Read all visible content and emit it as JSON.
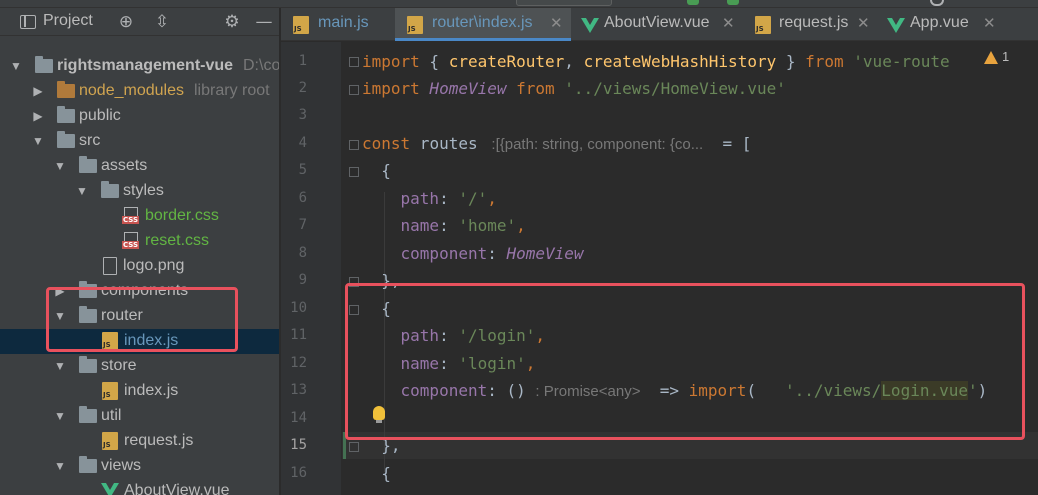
{
  "panel": {
    "title": "Project",
    "toolbar_icons": [
      "target-icon",
      "collapse-icon",
      "gear-icon",
      "minimize-icon"
    ]
  },
  "tree": {
    "root": {
      "label": "rightsmanagement-vue",
      "path_hint": "D:\\co"
    },
    "items": [
      {
        "label": "node_modules",
        "hint": "library root"
      },
      {
        "label": "public"
      },
      {
        "label": "src"
      },
      {
        "label": "assets"
      },
      {
        "label": "styles"
      },
      {
        "label": "border.css"
      },
      {
        "label": "reset.css"
      },
      {
        "label": "logo.png"
      },
      {
        "label": "components"
      },
      {
        "label": "router"
      },
      {
        "label": "index.js"
      },
      {
        "label": "store"
      },
      {
        "label": "index.js"
      },
      {
        "label": "util"
      },
      {
        "label": "request.js"
      },
      {
        "label": "views"
      },
      {
        "label": "AboutView.vue"
      }
    ]
  },
  "tabs": [
    {
      "label": "main.js",
      "icon": "js-file-icon"
    },
    {
      "label": "router\\index.js",
      "icon": "js-file-icon",
      "active": true
    },
    {
      "label": "AboutView.vue",
      "icon": "vue-file-icon"
    },
    {
      "label": "request.js",
      "icon": "js-file-icon"
    },
    {
      "label": "App.vue",
      "icon": "vue-file-icon"
    }
  ],
  "editor": {
    "line_numbers": [
      "1",
      "2",
      "3",
      "4",
      "5",
      "6",
      "7",
      "8",
      "9",
      "10",
      "11",
      "12",
      "13",
      "14",
      "15",
      "16"
    ],
    "current_line": "15",
    "warning_count": "1",
    "code": {
      "l1": {
        "kw1": "import",
        "p1": " { ",
        "fn1": "createRouter",
        "p2": ", ",
        "fn2": "createWebHashHistory",
        "p3": " } ",
        "kw2": "from",
        "s1": " 'vue-route"
      },
      "l2": {
        "kw1": "import",
        "cls": " HomeView ",
        "kw2": "from",
        "s1": " '../views/HomeView.vue'"
      },
      "l4": {
        "kw1": "const",
        "id": " routes ",
        "hint": " :[{path: string, component: {co...",
        "rest": "  = ["
      },
      "l5": "  {",
      "l6": {
        "prop": "    path",
        "p": ": ",
        "s": "'/'",
        "c": ","
      },
      "l7": {
        "prop": "    name",
        "p": ": ",
        "s": "'home'",
        "c": ","
      },
      "l8": {
        "prop": "    component",
        "p": ": ",
        "cls": "HomeView"
      },
      "l9": "  },",
      "l10": "  {",
      "l11": {
        "prop": "    path",
        "p": ": ",
        "s": "'/login'",
        "c": ","
      },
      "l12": {
        "prop": "    name",
        "p": ": ",
        "s": "'login'",
        "c": ","
      },
      "l13": {
        "prop": "    component",
        "p": ": () ",
        "hint": ": Promise<any>",
        "arrow": "  => ",
        "kw": "import",
        "p2": "(   ",
        "s1": "'../views/",
        "s2": "Login.vue",
        "s3": "'",
        "p3": ")"
      },
      "l15": "  },",
      "l16": "  {"
    }
  },
  "colors": {
    "annotation_box": "#e8515d",
    "selection": "#0d293e",
    "accent_tab": "#4a88c7"
  }
}
